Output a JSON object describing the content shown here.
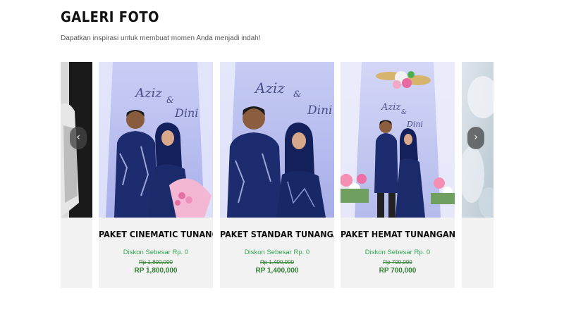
{
  "gallery": {
    "title": "GALERI FOTO",
    "subtitle": "Dapatkan inspirasi untuk membuat momen Anda menjadi indah!"
  },
  "nav": {
    "prev_icon": "‹",
    "next_icon": "›"
  },
  "packages": [
    {
      "name": "PAKET CINEMATIC TUNANGAN",
      "discount": "Diskon Sebesar Rp. 0",
      "old_price": "Rp 1,800,000",
      "price": "RP 1,800,000",
      "photo_text": "Aziz & Dini"
    },
    {
      "name": "PAKET STANDAR TUNANGAN",
      "discount": "Diskon Sebesar Rp. 0",
      "old_price": "Rp 1,400,000",
      "price": "RP 1,400,000",
      "photo_text": "Aziz & Dini"
    },
    {
      "name": "PAKET HEMAT TUNANGAN",
      "discount": "Diskon Sebesar Rp. 0",
      "old_price": "Rp 700,000",
      "price": "RP 700,000",
      "photo_text": "Aziz & Dini"
    }
  ],
  "colors": {
    "price_green": "#2e7d32",
    "discount_green": "#34a853",
    "card_bg": "#f2f2f2"
  }
}
